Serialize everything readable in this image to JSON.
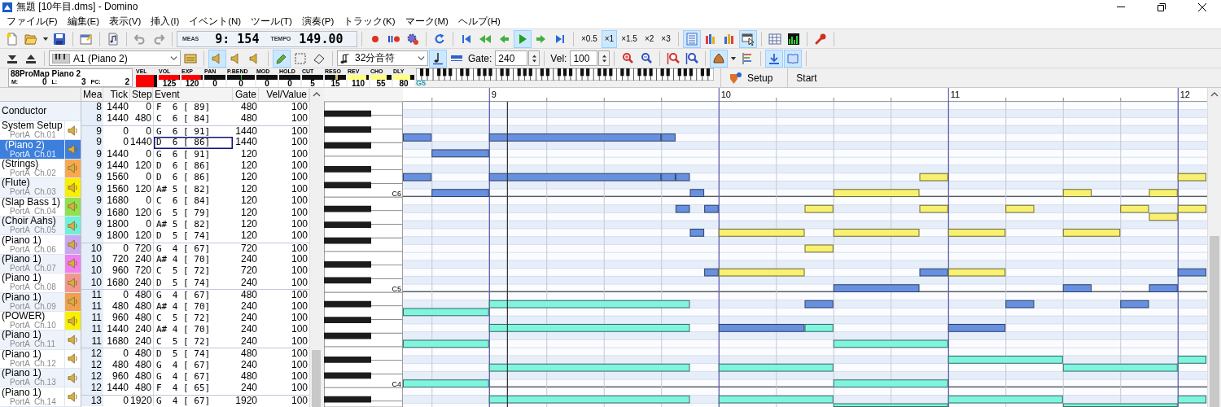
{
  "window": {
    "title": "無題 [10年目.dms] - Domino"
  },
  "menu": [
    "ファイル(F)",
    "編集(E)",
    "表示(V)",
    "挿入(I)",
    "イベント(N)",
    "ツール(T)",
    "演奏(P)",
    "トラック(K)",
    "マーク(M)",
    "ヘルプ(H)"
  ],
  "toolbar_1": {
    "leading_groups": [
      [
        {
          "kind": "new",
          "pressed": false
        },
        {
          "kind": "open",
          "pressed": false
        },
        {
          "kind": "dropdown",
          "pressed": false
        },
        {
          "kind": "save",
          "pressed": false
        }
      ],
      [
        {
          "kind": "properties",
          "pressed": false
        }
      ],
      [
        {
          "kind": "music_file",
          "pressed": false
        }
      ],
      [
        {
          "kind": "undo",
          "pressed": false
        },
        {
          "kind": "redo",
          "pressed": false
        }
      ]
    ],
    "counter": {
      "measure_label": "MEAS",
      "measure": "9: 154",
      "tempo_label": "TEMPO",
      "tempo": "149.00"
    },
    "transport_groups": [
      [
        {
          "kind": "record",
          "pressed": false
        },
        {
          "kind": "pause_record",
          "pressed": false
        },
        {
          "kind": "gear",
          "pressed": false
        }
      ],
      [
        {
          "kind": "loop",
          "pressed": false
        }
      ],
      [
        {
          "kind": "to_start",
          "pressed": false
        },
        {
          "kind": "rewind",
          "pressed": false
        },
        {
          "kind": "step_back",
          "pressed": false
        },
        {
          "kind": "play",
          "pressed": true
        },
        {
          "kind": "step_forward",
          "pressed": false
        },
        {
          "kind": "to_end",
          "pressed": false
        }
      ]
    ],
    "speeds": [
      {
        "label": "×0.5",
        "selected": false
      },
      {
        "label": "×1",
        "selected": true
      },
      {
        "label": "×1.5",
        "selected": false
      },
      {
        "label": "×2",
        "selected": false
      },
      {
        "label": "×3",
        "selected": false
      }
    ],
    "view_groups": [
      [
        {
          "kind": "list",
          "pressed": true
        },
        {
          "kind": "bars",
          "pressed": false
        },
        {
          "kind": "bars2",
          "pressed": false
        },
        {
          "kind": "pointer_window",
          "pressed": true
        }
      ],
      [
        {
          "kind": "grid",
          "pressed": false
        },
        {
          "kind": "meter",
          "pressed": false
        }
      ],
      [
        {
          "kind": "wrench",
          "pressed": false
        }
      ]
    ]
  },
  "toolbar_2": {
    "track_buttons": [
      {
        "kind": "tray_down",
        "pressed": false
      },
      {
        "kind": "eject",
        "pressed": false
      }
    ],
    "track_select": {
      "value": "A1 (Piano 2)"
    },
    "track_tools": [
      {
        "kind": "track_properties",
        "pressed": false
      }
    ],
    "monitor_buttons": [
      {
        "kind": "speaker",
        "pressed": true
      },
      {
        "kind": "speaker",
        "pressed": false
      },
      {
        "kind": "speaker",
        "pressed": false
      }
    ],
    "edit_tools": [
      {
        "kind": "pencil",
        "pressed": true
      },
      {
        "kind": "select_rect",
        "pressed": false
      },
      {
        "kind": "eraser",
        "pressed": false
      }
    ],
    "note_length": {
      "value": "32分音符"
    },
    "note_buttons": [
      {
        "kind": "note",
        "pressed": true
      },
      {
        "kind": "bar",
        "pressed": false
      }
    ],
    "gate": {
      "label": "Gate:",
      "value": "240"
    },
    "velocity": {
      "label": "Vel:",
      "value": "100"
    },
    "tail_groups": [
      [
        {
          "kind": "zoom_in",
          "pressed": false
        },
        {
          "kind": "zoom_out",
          "pressed": false
        }
      ],
      [
        {
          "kind": "vzoom_in",
          "pressed": false
        },
        {
          "kind": "vzoom_out",
          "pressed": false
        }
      ],
      [
        {
          "kind": "bell",
          "pressed": true
        },
        {
          "kind": "dropdown",
          "pressed": false
        },
        {
          "kind": "event_list",
          "pressed": false
        }
      ],
      [
        {
          "kind": "download",
          "pressed": true
        },
        {
          "kind": "book",
          "pressed": true
        }
      ]
    ]
  },
  "controller_strip": {
    "instrument": "88ProMap Piano 2",
    "fields": [
      {
        "label": "M:",
        "value": "0"
      },
      {
        "label": "L:",
        "value": "3"
      },
      {
        "label": "PC:",
        "value": "2"
      }
    ],
    "controllers": [
      {
        "label": "VEL",
        "kind": "velocity",
        "level": 0.85,
        "color": "#ff0000"
      },
      {
        "label": "VOL",
        "kind": "bar",
        "value": "125",
        "level": 0.98,
        "color": "#ff0000"
      },
      {
        "label": "EXP",
        "kind": "bar",
        "value": "120",
        "level": 0.94,
        "color": "#ff0000"
      },
      {
        "label": "PAN",
        "kind": "bar",
        "value": "0"
      },
      {
        "label": "P.BEND",
        "kind": "bend",
        "value": "0"
      },
      {
        "label": "MOD",
        "kind": "bar",
        "value": "0"
      },
      {
        "label": "HOLD",
        "kind": "bar",
        "value": "0"
      },
      {
        "label": "CUT",
        "kind": "bar",
        "value": "5"
      },
      {
        "label": "RESO",
        "kind": "marker",
        "value": "15",
        "level": 0.55,
        "color": "#e0b878"
      },
      {
        "label": "REV",
        "kind": "bar",
        "value": "110",
        "level": 0.87,
        "color": "#ffff80"
      },
      {
        "label": "CHO",
        "kind": "bar",
        "value": "55",
        "level": 0.75,
        "color": "#ffff80"
      },
      {
        "label": "DLY",
        "kind": "bar",
        "value": "80",
        "level": 0.8,
        "color": "#ffff80"
      }
    ],
    "key_label": "G5",
    "buttons": [
      {
        "label": "Setup",
        "icon": true
      },
      {
        "label": "Start",
        "icon": false
      }
    ]
  },
  "tracks": [
    {
      "kind": "conductor",
      "name": "Conductor",
      "selected": false
    },
    {
      "kind": "track",
      "name": "System Setup",
      "port": "PortA  Ch.01",
      "selected": false
    },
    {
      "kind": "track",
      "name": "(Piano 2)",
      "port": "PortA  Ch.01",
      "selected": true,
      "color": "#3d7fdc"
    },
    {
      "kind": "track",
      "name": "(Strings)",
      "port": "PortA  Ch.02",
      "selected": false,
      "color": "#f8a850"
    },
    {
      "kind": "track",
      "name": "(Flute)",
      "port": "PortA  Ch.03",
      "selected": false,
      "color": "#f8f000"
    },
    {
      "kind": "track",
      "name": "(Slap Bass 1)",
      "port": "PortA  Ch.04",
      "selected": false,
      "color": "#90e050"
    },
    {
      "kind": "track",
      "name": "(Choir Aahs)",
      "port": "PortA  Ch.05",
      "selected": false,
      "color": "#70f0d8"
    },
    {
      "kind": "track",
      "name": "(Piano 1)",
      "port": "PortA  Ch.06",
      "selected": false,
      "color": "#c8a8f0"
    },
    {
      "kind": "track",
      "name": "(Piano 1)",
      "port": "PortA  Ch.07",
      "selected": false,
      "color": "#f080f0"
    },
    {
      "kind": "track",
      "name": "(Piano 1)",
      "port": "PortA  Ch.08",
      "selected": false,
      "color": "#f09890"
    },
    {
      "kind": "track",
      "name": "(Piano 1)",
      "port": "PortA  Ch.09",
      "selected": false,
      "color": "#f0a050"
    },
    {
      "kind": "track",
      "name": "(POWER)",
      "port": "PortA  Ch.10",
      "selected": false,
      "color": "#f8f000"
    },
    {
      "kind": "track",
      "name": "(Piano 1)",
      "port": "PortA  Ch.11",
      "selected": false
    },
    {
      "kind": "track",
      "name": "(Piano 1)",
      "port": "PortA  Ch.12",
      "selected": false
    },
    {
      "kind": "track",
      "name": "(Piano 1)",
      "port": "PortA  Ch.13",
      "selected": false
    },
    {
      "kind": "track",
      "name": "(Piano 1)",
      "port": "PortA  Ch.14",
      "selected": false
    }
  ],
  "event_list": {
    "columns": [
      "Mea",
      "Tick",
      "Step",
      "Event",
      "Gate",
      "Vel/Value"
    ],
    "rows": [
      {
        "mea": "8",
        "tick": "1440",
        "step": "0",
        "event": "F  6 [ 89]",
        "gate": "480",
        "value": "100",
        "focused": false
      },
      {
        "mea": "8",
        "tick": "1440",
        "step": "480",
        "event": "C  6 [ 84]",
        "gate": "480",
        "value": "100",
        "focused": false
      },
      {
        "mea": "9",
        "tick": "0",
        "step": "0",
        "event": "G  6 [ 91]",
        "gate": "1440",
        "value": "100",
        "focused": false
      },
      {
        "mea": "9",
        "tick": "0",
        "step": "1440",
        "event": "D  6 [ 86]",
        "gate": "1440",
        "value": "100",
        "focused": true
      },
      {
        "mea": "9",
        "tick": "1440",
        "step": "0",
        "event": "G  6 [ 91]",
        "gate": "120",
        "value": "100",
        "focused": false
      },
      {
        "mea": "9",
        "tick": "1440",
        "step": "120",
        "event": "D  6 [ 86]",
        "gate": "120",
        "value": "100",
        "focused": false
      },
      {
        "mea": "9",
        "tick": "1560",
        "step": "0",
        "event": "D  6 [ 86]",
        "gate": "120",
        "value": "100",
        "focused": false
      },
      {
        "mea": "9",
        "tick": "1560",
        "step": "120",
        "event": "A# 5 [ 82]",
        "gate": "120",
        "value": "100",
        "focused": false
      },
      {
        "mea": "9",
        "tick": "1680",
        "step": "0",
        "event": "C  6 [ 84]",
        "gate": "120",
        "value": "100",
        "focused": false
      },
      {
        "mea": "9",
        "tick": "1680",
        "step": "120",
        "event": "G  5 [ 79]",
        "gate": "120",
        "value": "100",
        "focused": false
      },
      {
        "mea": "9",
        "tick": "1800",
        "step": "0",
        "event": "A# 5 [ 82]",
        "gate": "120",
        "value": "100",
        "focused": false
      },
      {
        "mea": "9",
        "tick": "1800",
        "step": "120",
        "event": "D  5 [ 74]",
        "gate": "120",
        "value": "100",
        "focused": false
      },
      {
        "mea": "10",
        "tick": "0",
        "step": "720",
        "event": "G  4 [ 67]",
        "gate": "720",
        "value": "100",
        "focused": false
      },
      {
        "mea": "10",
        "tick": "720",
        "step": "240",
        "event": "A# 4 [ 70]",
        "gate": "240",
        "value": "100",
        "focused": false
      },
      {
        "mea": "10",
        "tick": "960",
        "step": "720",
        "event": "C  5 [ 72]",
        "gate": "720",
        "value": "100",
        "focused": false
      },
      {
        "mea": "10",
        "tick": "1680",
        "step": "240",
        "event": "D  5 [ 74]",
        "gate": "240",
        "value": "100",
        "focused": false
      },
      {
        "mea": "11",
        "tick": "0",
        "step": "480",
        "event": "G  4 [ 67]",
        "gate": "480",
        "value": "100",
        "focused": false
      },
      {
        "mea": "11",
        "tick": "480",
        "step": "480",
        "event": "A# 4 [ 70]",
        "gate": "240",
        "value": "100",
        "focused": false
      },
      {
        "mea": "11",
        "tick": "960",
        "step": "480",
        "event": "C  5 [ 72]",
        "gate": "240",
        "value": "100",
        "focused": false
      },
      {
        "mea": "11",
        "tick": "1440",
        "step": "240",
        "event": "A# 4 [ 70]",
        "gate": "240",
        "value": "100",
        "focused": false
      },
      {
        "mea": "11",
        "tick": "1680",
        "step": "240",
        "event": "C  5 [ 72]",
        "gate": "240",
        "value": "100",
        "focused": false
      },
      {
        "mea": "12",
        "tick": "0",
        "step": "480",
        "event": "D  5 [ 74]",
        "gate": "480",
        "value": "100",
        "focused": false
      },
      {
        "mea": "12",
        "tick": "480",
        "step": "480",
        "event": "G  4 [ 67]",
        "gate": "240",
        "value": "100",
        "focused": false
      },
      {
        "mea": "12",
        "tick": "960",
        "step": "480",
        "event": "G  4 [ 67]",
        "gate": "480",
        "value": "100",
        "focused": false
      },
      {
        "mea": "12",
        "tick": "1440",
        "step": "480",
        "event": "F  4 [ 65]",
        "gate": "240",
        "value": "100",
        "focused": false
      },
      {
        "mea": "13",
        "tick": "0",
        "step": "1920",
        "event": "G  4 [ 67]",
        "gate": "1920",
        "value": "100",
        "focused": false
      }
    ]
  },
  "piano_roll": {
    "measures": [
      "9",
      "10",
      "11",
      "12"
    ],
    "octave_labels": [
      "C6",
      "C5",
      "C4"
    ]
  }
}
